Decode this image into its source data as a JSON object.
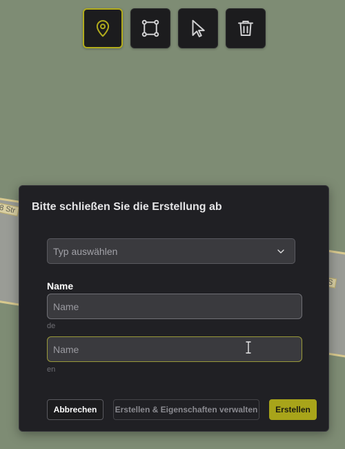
{
  "map": {
    "street_label_left": "8 Str",
    "street_label_right": "S"
  },
  "toolbar": {
    "tools": [
      {
        "name": "place-marker",
        "icon": "map-pin-icon",
        "active": true
      },
      {
        "name": "draw-area",
        "icon": "square-vertices-icon",
        "active": false
      },
      {
        "name": "select",
        "icon": "pointer-arrow-icon",
        "active": false
      },
      {
        "name": "delete",
        "icon": "trash-icon",
        "active": false
      }
    ],
    "active_color": "#b2ac1c"
  },
  "dialog": {
    "title": "Bitte schließen Sie die Erstellung ab",
    "type_select": {
      "placeholder": "Typ auswählen"
    },
    "name_label": "Name",
    "name_fields": [
      {
        "lang": "de",
        "value": "",
        "placeholder": "Name"
      },
      {
        "lang": "en",
        "value": "",
        "placeholder": "Name"
      }
    ],
    "buttons": {
      "cancel": "Abbrechen",
      "create_manage": "Erstellen & Eigenschaften verwalten",
      "create": "Erstellen"
    },
    "accent_color": "#a8a41a"
  }
}
